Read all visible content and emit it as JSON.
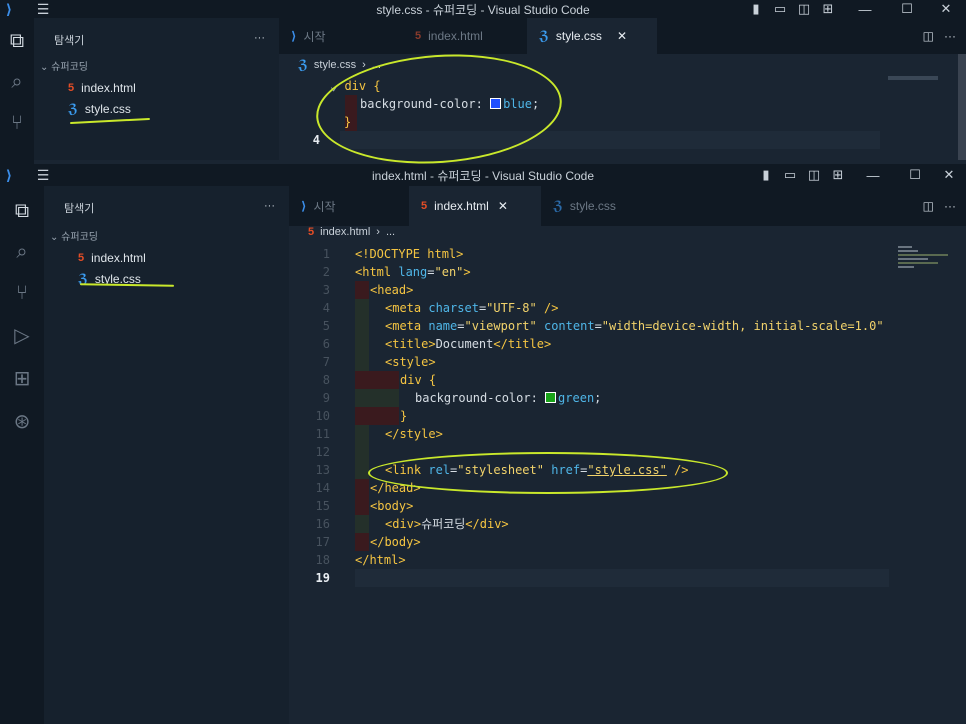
{
  "back_window": {
    "title": "style.css - 슈퍼코딩 - Visual Studio Code",
    "explorer_title": "탐색기",
    "more": "···",
    "folder": "슈퍼코딩",
    "files": [
      "index.html",
      "style.css"
    ],
    "tabs": [
      "시작",
      "index.html",
      "style.css"
    ],
    "breadcrumb": "style.css",
    "breadcrumb_more": "...",
    "code": {
      "selector": "div",
      "open_brace": "{",
      "property": "background-color:",
      "value": "blue",
      "semicolon": ";",
      "close_brace": "}",
      "current_line_number": "4"
    },
    "swatch_color": "#1f4fff"
  },
  "front_window": {
    "title": "index.html - 슈퍼코딩 - Visual Studio Code",
    "explorer_title": "탐색기",
    "more": "···",
    "folder": "슈퍼코딩",
    "files": [
      "index.html",
      "style.css"
    ],
    "tabs": [
      "시작",
      "index.html",
      "style.css"
    ],
    "breadcrumb": "index.html",
    "breadcrumb_more": "...",
    "swatch_color": "#19a319",
    "line_numbers": [
      "1",
      "2",
      "3",
      "4",
      "5",
      "6",
      "7",
      "8",
      "9",
      "10",
      "11",
      "12",
      "13",
      "14",
      "15",
      "16",
      "17",
      "18",
      "19"
    ],
    "lines": {
      "l1": "<!DOCTYPE html>",
      "l2a": "<html ",
      "l2b": "lang",
      "l2c": "=",
      "l2d": "\"en\"",
      "l2e": ">",
      "l3": "<head>",
      "l4a": "<meta ",
      "l4b": "charset",
      "l4c": "=",
      "l4d": "\"UTF-8\"",
      "l4e": " />",
      "l5a": "<meta ",
      "l5b": "name",
      "l5c": "=",
      "l5d": "\"viewport\"",
      "l5e": " ",
      "l5f": "content",
      "l5g": "=",
      "l5h": "\"width=device-width, initial-scale=1.0\"",
      "l6a": "<title>",
      "l6b": "Document",
      "l6c": "</title>",
      "l7": "<style>",
      "l8a": "div",
      "l8b": " {",
      "l9a": "background-color: ",
      "l9b": "green",
      "l9c": ";",
      "l10": "}",
      "l11": "</style>",
      "l13a": "<link ",
      "l13b": "rel",
      "l13c": "=",
      "l13d": "\"stylesheet\"",
      "l13e": " ",
      "l13f": "href",
      "l13g": "=",
      "l13h": "\"style.css\"",
      "l13i": " />",
      "l14": "</head>",
      "l15": "<body>",
      "l16a": "<div>",
      "l16b": "슈퍼코딩",
      "l16c": "</div>",
      "l17": "</body>",
      "l18": "</html>"
    }
  },
  "icons": {
    "logo": "vscode-logo-icon",
    "menu": "hamburger-menu-icon"
  },
  "colors": {
    "highlight": "#c9e82b",
    "tag": "#f5c542",
    "attr": "#4fb6e8"
  }
}
